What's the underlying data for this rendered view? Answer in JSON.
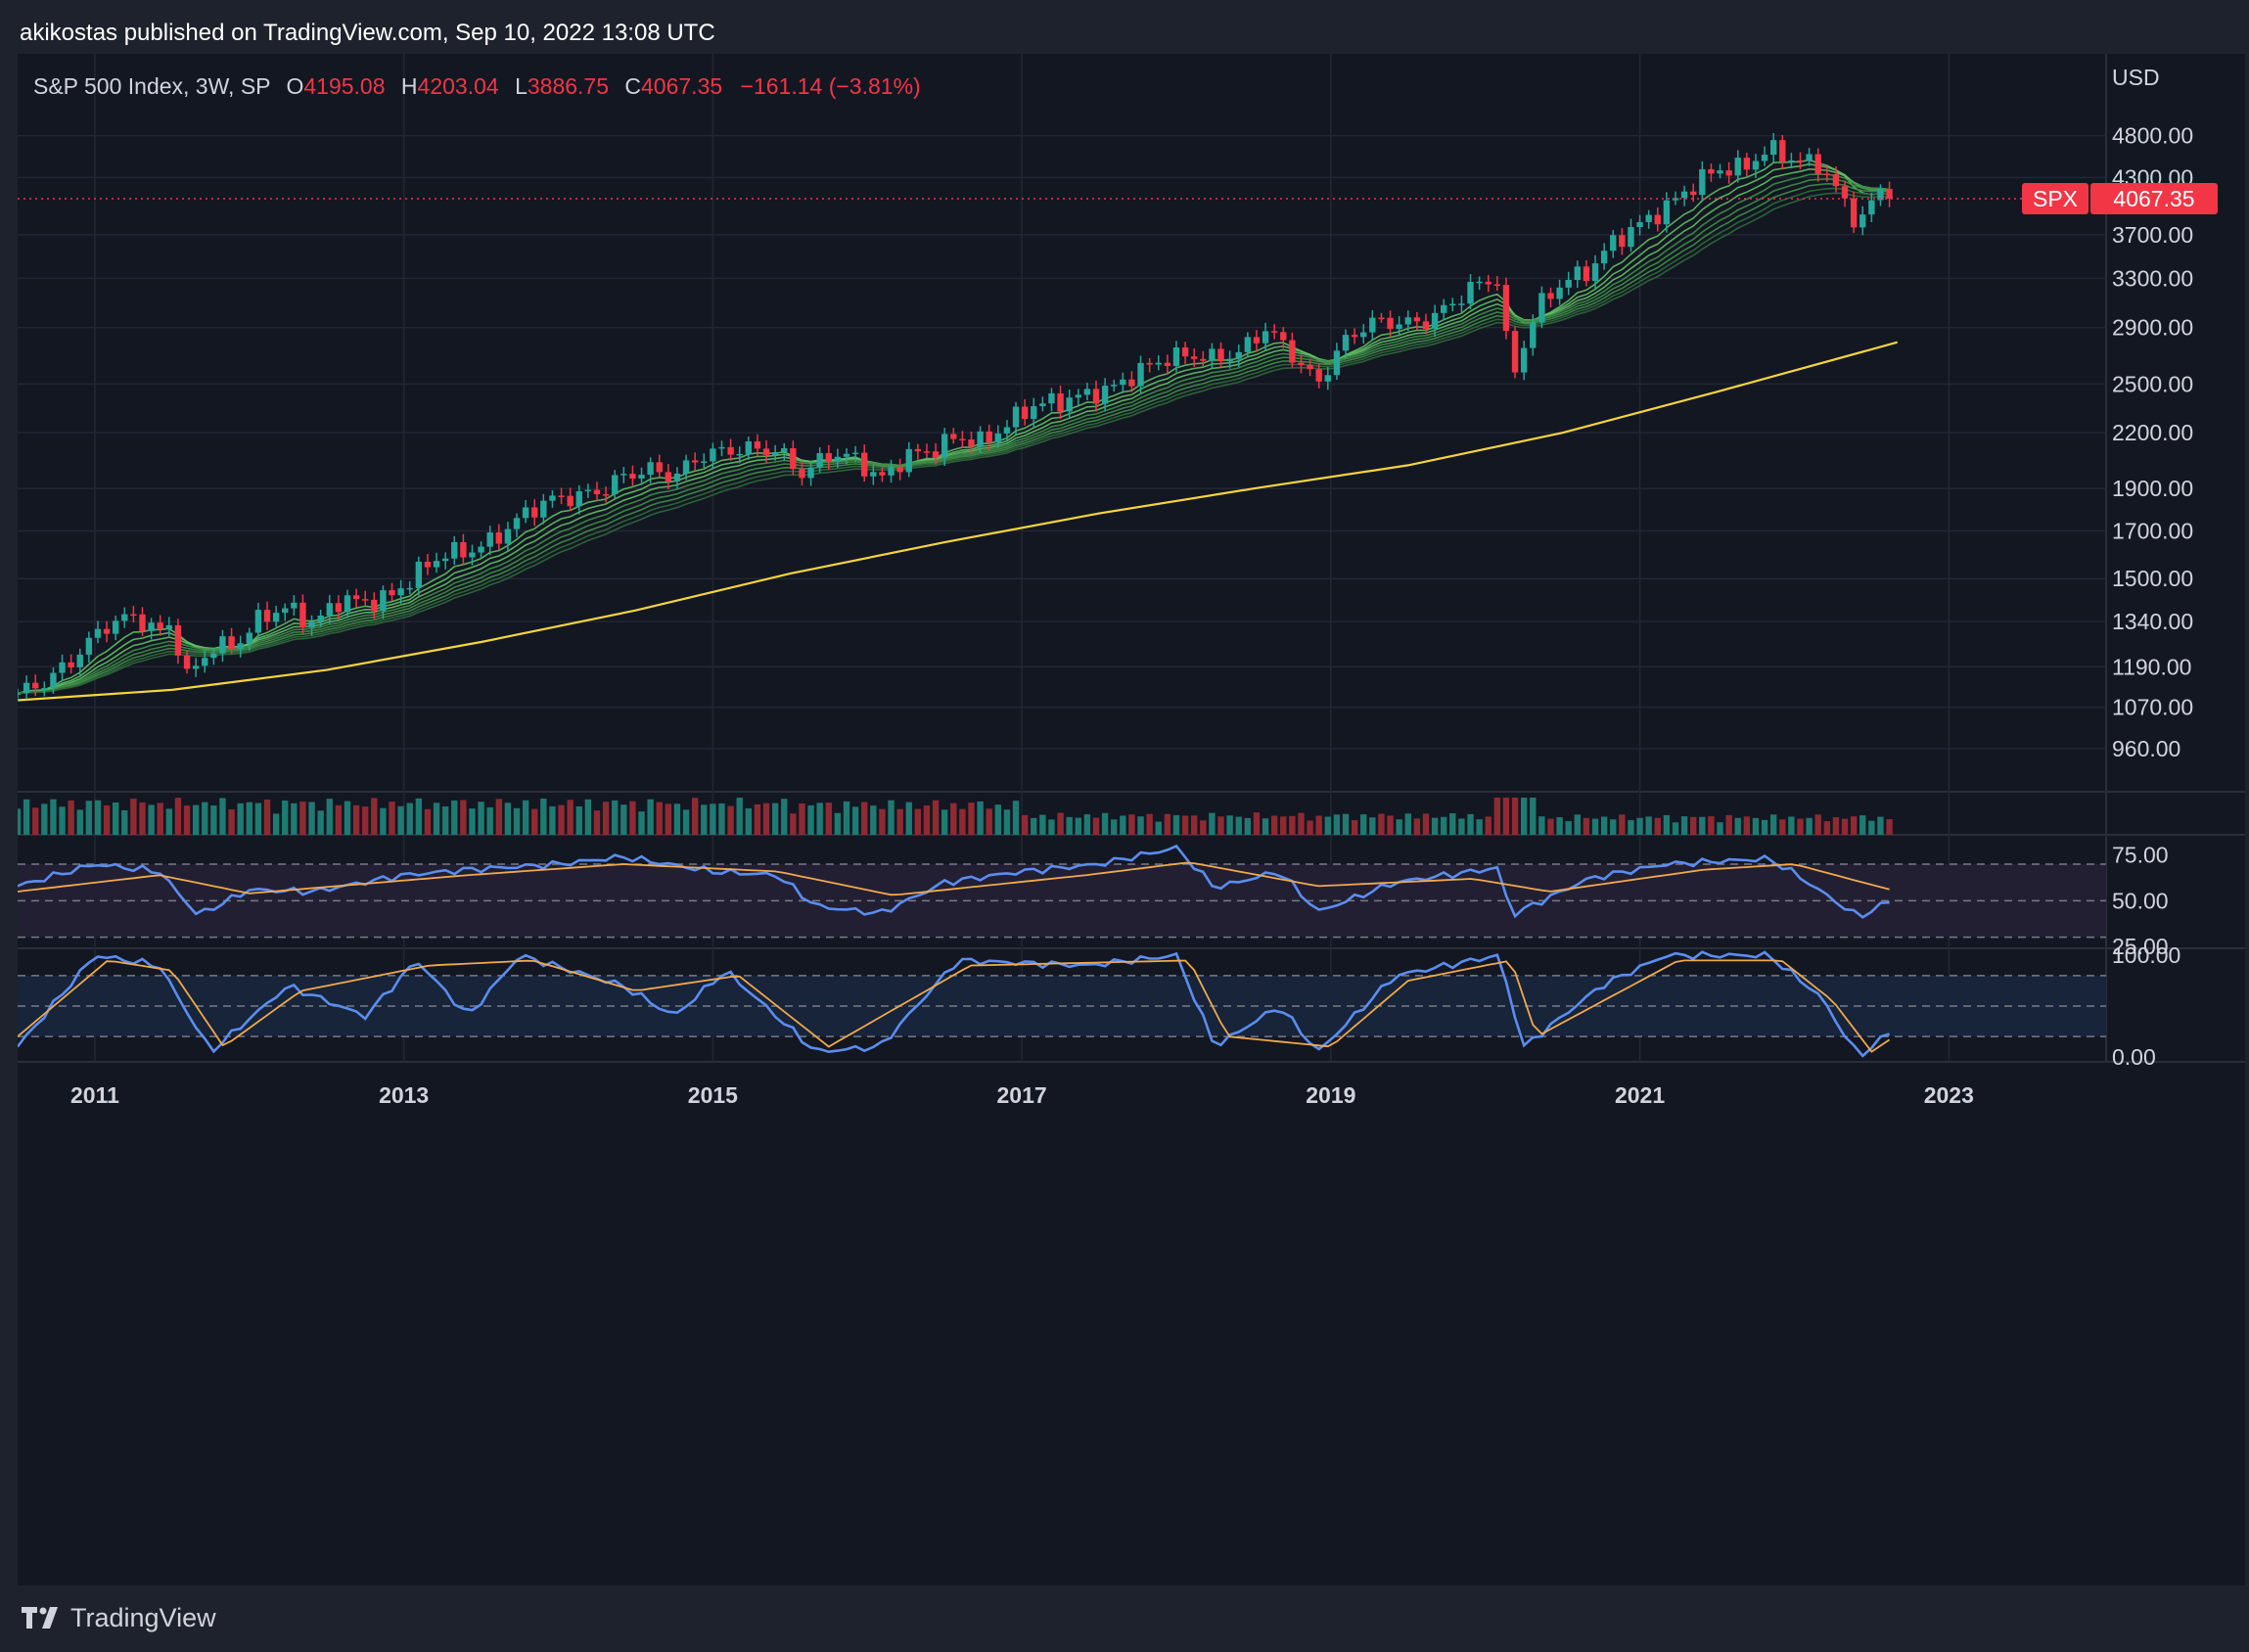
{
  "publisher": "akikostas published on TradingView.com, Sep 10, 2022 13:08 UTC",
  "legend": {
    "symbol_info": "S&P 500 Index, 3W, SP",
    "open_label": "O",
    "open": "4195.08",
    "high_label": "H",
    "high": "4203.04",
    "low_label": "L",
    "low": "3886.75",
    "close_label": "C",
    "close": "4067.35",
    "change": "−161.14 (−3.81%)"
  },
  "currency": "USD",
  "price_tag": {
    "symbol": "SPX",
    "value": "4067.35"
  },
  "footer": {
    "brand": "TradingView"
  },
  "colors": {
    "up": "#26a69a",
    "down": "#f23645",
    "ma_long": "#f5d53b",
    "rsi": "#5b8def",
    "signal": "#f0a94b",
    "ribbon": "#4caf50"
  },
  "chart_data": [
    {
      "type": "candlestick",
      "title": "S&P 500 Index, 3W, SP",
      "scale": "log",
      "ylim": [
        900,
        5100
      ],
      "xlim": [
        "2010-07",
        "2023-12"
      ],
      "x_ticks": [
        "2011",
        "2013",
        "2015",
        "2017",
        "2019",
        "2021",
        "2023"
      ],
      "y_ticks": [
        "4800.00",
        "4300.00",
        "3700.00",
        "3300.00",
        "2900.00",
        "2500.00",
        "2200.00",
        "1900.00",
        "1700.00",
        "1500.00",
        "1340.00",
        "1190.00",
        "1070.00",
        "960.00"
      ],
      "last_close": 4067.35,
      "closes": [
        {
          "d": "2010-07",
          "v": 1110
        },
        {
          "d": "2010-09",
          "v": 1140
        },
        {
          "d": "2010-11",
          "v": 1200
        },
        {
          "d": "2011-01",
          "v": 1290
        },
        {
          "d": "2011-02",
          "v": 1330
        },
        {
          "d": "2011-04",
          "v": 1360
        },
        {
          "d": "2011-06",
          "v": 1300
        },
        {
          "d": "2011-07",
          "v": 1340
        },
        {
          "d": "2011-08",
          "v": 1150
        },
        {
          "d": "2011-10",
          "v": 1250
        },
        {
          "d": "2011-12",
          "v": 1260
        },
        {
          "d": "2012-02",
          "v": 1360
        },
        {
          "d": "2012-04",
          "v": 1390
        },
        {
          "d": "2012-06",
          "v": 1330
        },
        {
          "d": "2012-08",
          "v": 1420
        },
        {
          "d": "2012-10",
          "v": 1410
        },
        {
          "d": "2012-12",
          "v": 1430
        },
        {
          "d": "2013-02",
          "v": 1520
        },
        {
          "d": "2013-04",
          "v": 1600
        },
        {
          "d": "2013-06",
          "v": 1610
        },
        {
          "d": "2013-08",
          "v": 1660
        },
        {
          "d": "2013-10",
          "v": 1760
        },
        {
          "d": "2013-12",
          "v": 1840
        },
        {
          "d": "2014-02",
          "v": 1860
        },
        {
          "d": "2014-04",
          "v": 1880
        },
        {
          "d": "2014-06",
          "v": 1960
        },
        {
          "d": "2014-08",
          "v": 2000
        },
        {
          "d": "2014-10",
          "v": 1960
        },
        {
          "d": "2014-12",
          "v": 2070
        },
        {
          "d": "2015-02",
          "v": 2100
        },
        {
          "d": "2015-04",
          "v": 2110
        },
        {
          "d": "2015-06",
          "v": 2100
        },
        {
          "d": "2015-08",
          "v": 1970
        },
        {
          "d": "2015-10",
          "v": 2080
        },
        {
          "d": "2015-12",
          "v": 2060
        },
        {
          "d": "2016-02",
          "v": 1940
        },
        {
          "d": "2016-04",
          "v": 2070
        },
        {
          "d": "2016-06",
          "v": 2100
        },
        {
          "d": "2016-08",
          "v": 2180
        },
        {
          "d": "2016-10",
          "v": 2140
        },
        {
          "d": "2016-12",
          "v": 2260
        },
        {
          "d": "2017-02",
          "v": 2370
        },
        {
          "d": "2017-04",
          "v": 2390
        },
        {
          "d": "2017-06",
          "v": 2430
        },
        {
          "d": "2017-08",
          "v": 2470
        },
        {
          "d": "2017-10",
          "v": 2580
        },
        {
          "d": "2017-12",
          "v": 2670
        },
        {
          "d": "2018-02",
          "v": 2700
        },
        {
          "d": "2018-04",
          "v": 2670
        },
        {
          "d": "2018-06",
          "v": 2720
        },
        {
          "d": "2018-08",
          "v": 2900
        },
        {
          "d": "2018-10",
          "v": 2700
        },
        {
          "d": "2018-12",
          "v": 2500
        },
        {
          "d": "2019-02",
          "v": 2790
        },
        {
          "d": "2019-04",
          "v": 2940
        },
        {
          "d": "2019-06",
          "v": 2940
        },
        {
          "d": "2019-08",
          "v": 2930
        },
        {
          "d": "2019-10",
          "v": 3050
        },
        {
          "d": "2019-12",
          "v": 3230
        },
        {
          "d": "2020-02",
          "v": 3300
        },
        {
          "d": "2020-03",
          "v": 2500
        },
        {
          "d": "2020-05",
          "v": 3050
        },
        {
          "d": "2020-07",
          "v": 3270
        },
        {
          "d": "2020-09",
          "v": 3360
        },
        {
          "d": "2020-11",
          "v": 3640
        },
        {
          "d": "2021-01",
          "v": 3800
        },
        {
          "d": "2021-03",
          "v": 3970
        },
        {
          "d": "2021-05",
          "v": 4200
        },
        {
          "d": "2021-07",
          "v": 4400
        },
        {
          "d": "2021-09",
          "v": 4400
        },
        {
          "d": "2021-11",
          "v": 4640
        },
        {
          "d": "2022-01",
          "v": 4500
        },
        {
          "d": "2022-03",
          "v": 4450
        },
        {
          "d": "2022-05",
          "v": 4000
        },
        {
          "d": "2022-06",
          "v": 3800
        },
        {
          "d": "2022-08",
          "v": 4228
        },
        {
          "d": "2022-09",
          "v": 4067
        }
      ],
      "ma_long": [
        {
          "d": "2010-07",
          "v": 1090
        },
        {
          "d": "2011-07",
          "v": 1120
        },
        {
          "d": "2012-07",
          "v": 1180
        },
        {
          "d": "2013-07",
          "v": 1270
        },
        {
          "d": "2014-07",
          "v": 1380
        },
        {
          "d": "2015-07",
          "v": 1520
        },
        {
          "d": "2016-07",
          "v": 1650
        },
        {
          "d": "2017-07",
          "v": 1780
        },
        {
          "d": "2018-07",
          "v": 1900
        },
        {
          "d": "2019-07",
          "v": 2020
        },
        {
          "d": "2020-07",
          "v": 2200
        },
        {
          "d": "2021-07",
          "v": 2450
        },
        {
          "d": "2022-09",
          "v": 2790
        }
      ]
    },
    {
      "type": "bar",
      "title": "Volume",
      "color_rule": "up/down by candle"
    },
    {
      "type": "line",
      "title": "RSI",
      "ylim": [
        25,
        85
      ],
      "y_ticks": [
        "75.00",
        "50.00",
        "25.00"
      ],
      "bands": [
        30,
        50,
        70
      ],
      "rsi": [
        {
          "d": "2010-07",
          "v": 58
        },
        {
          "d": "2011-01",
          "v": 70
        },
        {
          "d": "2011-06",
          "v": 66
        },
        {
          "d": "2011-09",
          "v": 42
        },
        {
          "d": "2012-01",
          "v": 56
        },
        {
          "d": "2012-06",
          "v": 55
        },
        {
          "d": "2013-01",
          "v": 64
        },
        {
          "d": "2013-06",
          "v": 67
        },
        {
          "d": "2014-01",
          "v": 70
        },
        {
          "d": "2014-06",
          "v": 74
        },
        {
          "d": "2015-01",
          "v": 66
        },
        {
          "d": "2015-06",
          "v": 64
        },
        {
          "d": "2015-09",
          "v": 47
        },
        {
          "d": "2016-02",
          "v": 43
        },
        {
          "d": "2016-07",
          "v": 60
        },
        {
          "d": "2017-01",
          "v": 66
        },
        {
          "d": "2017-07",
          "v": 70
        },
        {
          "d": "2018-01",
          "v": 79
        },
        {
          "d": "2018-04",
          "v": 57
        },
        {
          "d": "2018-09",
          "v": 66
        },
        {
          "d": "2018-12",
          "v": 44
        },
        {
          "d": "2019-06",
          "v": 60
        },
        {
          "d": "2020-02",
          "v": 68
        },
        {
          "d": "2020-03",
          "v": 42
        },
        {
          "d": "2020-09",
          "v": 62
        },
        {
          "d": "2021-03",
          "v": 70
        },
        {
          "d": "2021-11",
          "v": 73
        },
        {
          "d": "2022-01",
          "v": 65
        },
        {
          "d": "2022-06",
          "v": 41
        },
        {
          "d": "2022-09",
          "v": 52
        }
      ],
      "signal": [
        {
          "d": "2010-07",
          "v": 55
        },
        {
          "d": "2011-06",
          "v": 64
        },
        {
          "d": "2012-01",
          "v": 54
        },
        {
          "d": "2013-06",
          "v": 64
        },
        {
          "d": "2014-06",
          "v": 70
        },
        {
          "d": "2015-06",
          "v": 66
        },
        {
          "d": "2016-03",
          "v": 53
        },
        {
          "d": "2017-06",
          "v": 64
        },
        {
          "d": "2018-02",
          "v": 71
        },
        {
          "d": "2018-12",
          "v": 58
        },
        {
          "d": "2019-12",
          "v": 62
        },
        {
          "d": "2020-06",
          "v": 55
        },
        {
          "d": "2021-06",
          "v": 67
        },
        {
          "d": "2022-01",
          "v": 70
        },
        {
          "d": "2022-09",
          "v": 55
        }
      ]
    },
    {
      "type": "line",
      "title": "Stochastic RSI",
      "ylim": [
        -5,
        105
      ],
      "y_ticks": [
        "100.00",
        "0.00"
      ],
      "bands": [
        20,
        50,
        80
      ],
      "k": [
        {
          "d": "2010-07",
          "v": 10
        },
        {
          "d": "2011-01",
          "v": 100
        },
        {
          "d": "2011-06",
          "v": 90
        },
        {
          "d": "2011-10",
          "v": 5
        },
        {
          "d": "2012-04",
          "v": 70
        },
        {
          "d": "2012-10",
          "v": 40
        },
        {
          "d": "2013-02",
          "v": 95
        },
        {
          "d": "2013-06",
          "v": 40
        },
        {
          "d": "2013-10",
          "v": 100
        },
        {
          "d": "2014-06",
          "v": 70
        },
        {
          "d": "2014-10",
          "v": 40
        },
        {
          "d": "2015-02",
          "v": 85
        },
        {
          "d": "2015-09",
          "v": 5
        },
        {
          "d": "2016-02",
          "v": 10
        },
        {
          "d": "2016-08",
          "v": 95
        },
        {
          "d": "2017-06",
          "v": 90
        },
        {
          "d": "2018-01",
          "v": 100
        },
        {
          "d": "2018-04",
          "v": 10
        },
        {
          "d": "2018-09",
          "v": 50
        },
        {
          "d": "2018-12",
          "v": 5
        },
        {
          "d": "2019-06",
          "v": 80
        },
        {
          "d": "2020-02",
          "v": 100
        },
        {
          "d": "2020-04",
          "v": 10
        },
        {
          "d": "2020-10",
          "v": 70
        },
        {
          "d": "2021-03",
          "v": 100
        },
        {
          "d": "2021-11",
          "v": 100
        },
        {
          "d": "2022-03",
          "v": 60
        },
        {
          "d": "2022-06",
          "v": 0
        },
        {
          "d": "2022-09",
          "v": 30
        }
      ],
      "d": [
        {
          "d": "2010-07",
          "v": 20
        },
        {
          "d": "2011-02",
          "v": 95
        },
        {
          "d": "2011-07",
          "v": 85
        },
        {
          "d": "2011-11",
          "v": 10
        },
        {
          "d": "2012-05",
          "v": 65
        },
        {
          "d": "2013-03",
          "v": 90
        },
        {
          "d": "2013-11",
          "v": 95
        },
        {
          "d": "2014-07",
          "v": 65
        },
        {
          "d": "2015-03",
          "v": 80
        },
        {
          "d": "2015-10",
          "v": 10
        },
        {
          "d": "2016-09",
          "v": 90
        },
        {
          "d": "2018-02",
          "v": 95
        },
        {
          "d": "2018-05",
          "v": 20
        },
        {
          "d": "2019-01",
          "v": 10
        },
        {
          "d": "2019-07",
          "v": 75
        },
        {
          "d": "2020-03",
          "v": 95
        },
        {
          "d": "2020-05",
          "v": 20
        },
        {
          "d": "2021-04",
          "v": 95
        },
        {
          "d": "2021-12",
          "v": 95
        },
        {
          "d": "2022-04",
          "v": 55
        },
        {
          "d": "2022-07",
          "v": 5
        },
        {
          "d": "2022-09",
          "v": 22
        }
      ]
    }
  ]
}
